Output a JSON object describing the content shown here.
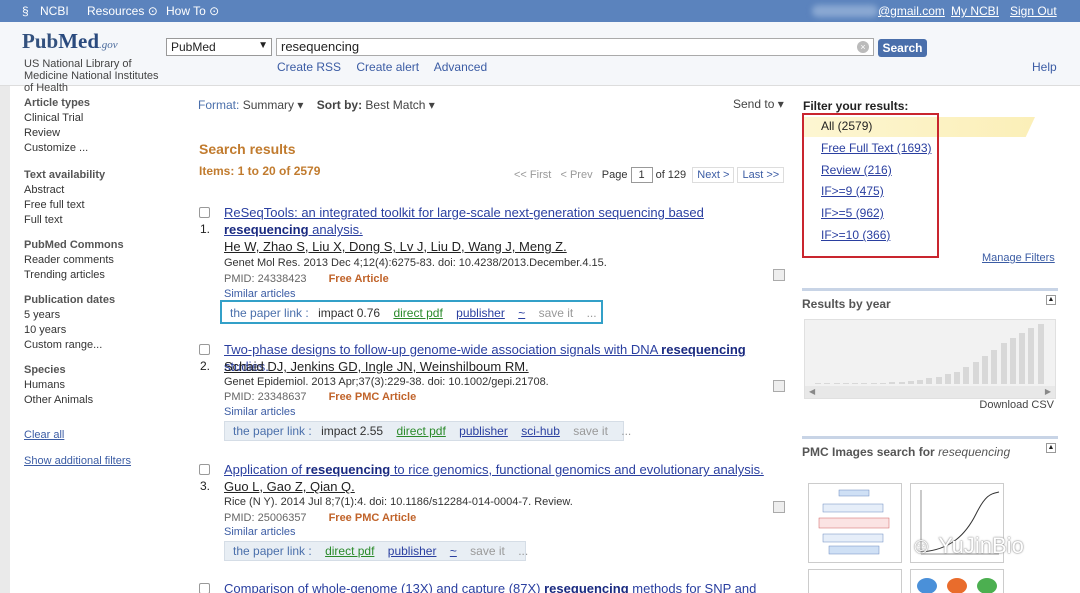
{
  "topbar": {
    "ncbi": "NCBI",
    "resources": "Resources",
    "howto": "How To",
    "email_suffix": "@gmail.com",
    "my_ncbi": "My NCBI",
    "sign_out": "Sign Out"
  },
  "header": {
    "logo_pub": "Pub",
    "logo_med": "Med",
    "logo_gov": ".gov",
    "nlm": "US National Library of Medicine National Institutes of Health",
    "db_value": "PubMed",
    "search_value": "resequencing",
    "search_button": "Search",
    "create_rss": "Create RSS",
    "create_alert": "Create alert",
    "advanced": "Advanced",
    "help": "Help"
  },
  "sidebar": {
    "article_types": "Article types",
    "clinical_trial": "Clinical Trial",
    "review": "Review",
    "customize": "Customize ...",
    "text_availability": "Text availability",
    "abstract": "Abstract",
    "free_full_text": "Free full text",
    "full_text": "Full text",
    "pubmed_commons": "PubMed Commons",
    "reader_comments": "Reader comments",
    "trending": "Trending articles",
    "pub_dates": "Publication dates",
    "five_years": "5 years",
    "ten_years": "10 years",
    "custom_range": "Custom range...",
    "species": "Species",
    "humans": "Humans",
    "other_animals": "Other Animals",
    "clear_all": "Clear all",
    "show_filters": "Show additional filters"
  },
  "main": {
    "format_label": "Format:",
    "format_value": "Summary",
    "sortby_label": "Sort by:",
    "sortby_value": "Best Match",
    "send_to": "Send to",
    "search_results": "Search results",
    "items": "Items: 1 to 20 of 2579",
    "pager": {
      "first": "<< First",
      "prev": "< Prev",
      "page_label": "Page",
      "page_value": "1",
      "of": "of 129",
      "next": "Next >",
      "last": "Last >>"
    },
    "results": [
      {
        "num": "1.",
        "title_pre": "ReSeqTools: an integrated toolkit for large-scale next-generation sequencing based ",
        "title_bold": "resequencing",
        "title_post": " analysis.",
        "authors": "He W, Zhao S, Liu X, Dong S, Lv J, Liu D, Wang J, Meng Z.",
        "citation": "Genet Mol Res. 2013 Dec 4;12(4):6275-83. doi: 10.4238/2013.December.4.15.",
        "pmid": "PMID: 24338423",
        "free": "Free Article",
        "similar": "Similar articles",
        "tool_label": "the paper link :",
        "impact": "impact 0.76",
        "pdf": "direct pdf",
        "publisher": "publisher",
        "extra": "~",
        "save": "save it",
        "dots": "..."
      },
      {
        "num": "2.",
        "title_pre": "Two-phase designs to follow-up genome-wide association signals with DNA ",
        "title_bold": "resequencing",
        "title_post": " studies.",
        "authors": "Schaid DJ, Jenkins GD, Ingle JN, Weinshilboum RM.",
        "citation": "Genet Epidemiol. 2013 Apr;37(3):229-38. doi: 10.1002/gepi.21708.",
        "pmid": "PMID: 23348637",
        "free": "Free PMC Article",
        "similar": "Similar articles",
        "tool_label": "the paper link :",
        "impact": "impact 2.55",
        "pdf": "direct pdf",
        "publisher": "publisher",
        "extra": "sci-hub",
        "save": "save it",
        "dots": "..."
      },
      {
        "num": "3.",
        "title_pre": "Application of ",
        "title_bold": "resequencing",
        "title_post": " to rice genomics, functional genomics and evolutionary analysis.",
        "authors": "Guo L, Gao Z, Qian Q.",
        "citation": "Rice (N Y). 2014 Jul 8;7(1):4. doi: 10.1186/s12284-014-0004-7. Review.",
        "pmid": "PMID: 25006357",
        "free": "Free PMC Article",
        "similar": "Similar articles",
        "tool_label": "the paper link :",
        "pdf": "direct pdf",
        "publisher": "publisher",
        "extra": "~",
        "save": "save it",
        "dots": "..."
      },
      {
        "title_pre": "Comparison of whole-genome (13X) and capture (87X) ",
        "title_bold": "resequencing",
        "title_post": " methods for SNP and"
      }
    ]
  },
  "filters": {
    "heading": "Filter your results:",
    "all": "All (2579)",
    "free_full": "Free Full Text (1693)",
    "review": "Review (216)",
    "if9": "IF>=9 (475)",
    "if5": "IF>=5 (962)",
    "if10": "IF>=10 (366)",
    "manage": "Manage Filters"
  },
  "results_by_year": {
    "heading": "Results by year",
    "download": "Download CSV",
    "bars": [
      1,
      1,
      1,
      1,
      1,
      1,
      2,
      2,
      3,
      4,
      5,
      7,
      9,
      12,
      16,
      20,
      28,
      36,
      45,
      55,
      66,
      74,
      82,
      90,
      96
    ]
  },
  "pmc": {
    "heading": "PMC Images search for ",
    "term": "resequencing"
  },
  "watermark": "YuJinBio"
}
